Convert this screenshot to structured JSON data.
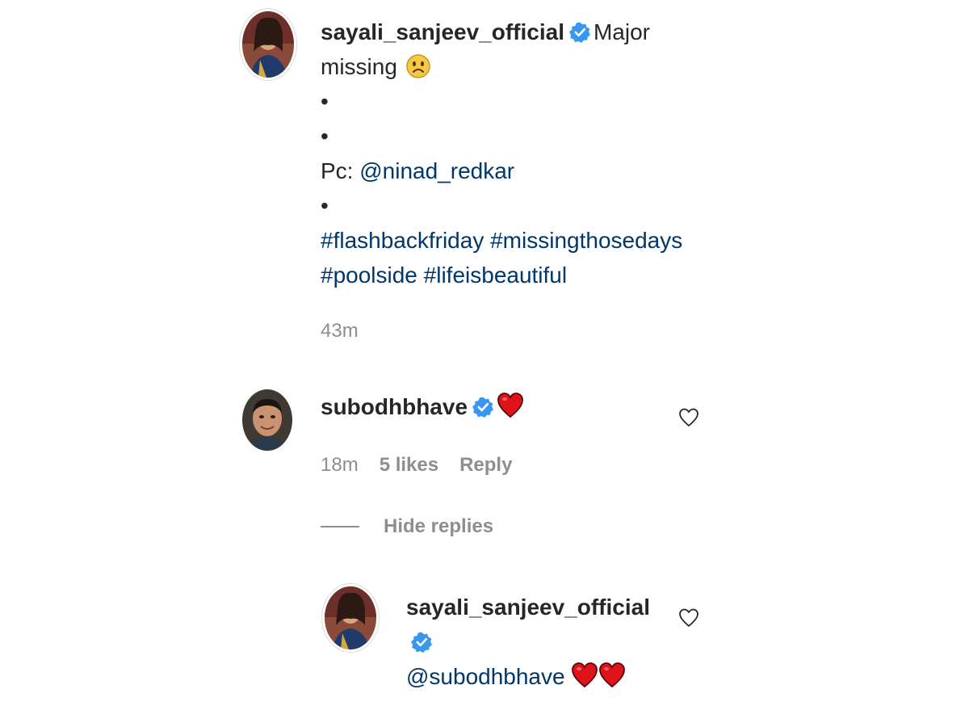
{
  "post": {
    "author": "sayali_sanjeev_official",
    "caption_text": "Major missing",
    "caption_emoji": "slightly-frowning-face",
    "bullets": [
      "•",
      "•"
    ],
    "credit_prefix": "Pc: ",
    "credit_mention": "@ninad_redkar",
    "bullet_after_credit": "•",
    "hashtags_line1": "#flashbackfriday #missingthosedays",
    "hashtags_line2": "#poolside #lifeisbeautiful",
    "time": "43m"
  },
  "comment": {
    "author": "subodhbhave",
    "emoji": "red-heart",
    "time": "18m",
    "likes": "5 likes",
    "reply_label": "Reply"
  },
  "replies_toggle": {
    "label": "Hide replies"
  },
  "reply": {
    "author": "sayali_sanjeev_official",
    "mention": "@subodhbhave",
    "emojis": [
      "red-heart",
      "red-heart"
    ]
  },
  "colors": {
    "text": "#262626",
    "muted": "#8e8e8e",
    "link": "#00376b",
    "verified": "#3897f0",
    "heart": "#e0131b"
  }
}
